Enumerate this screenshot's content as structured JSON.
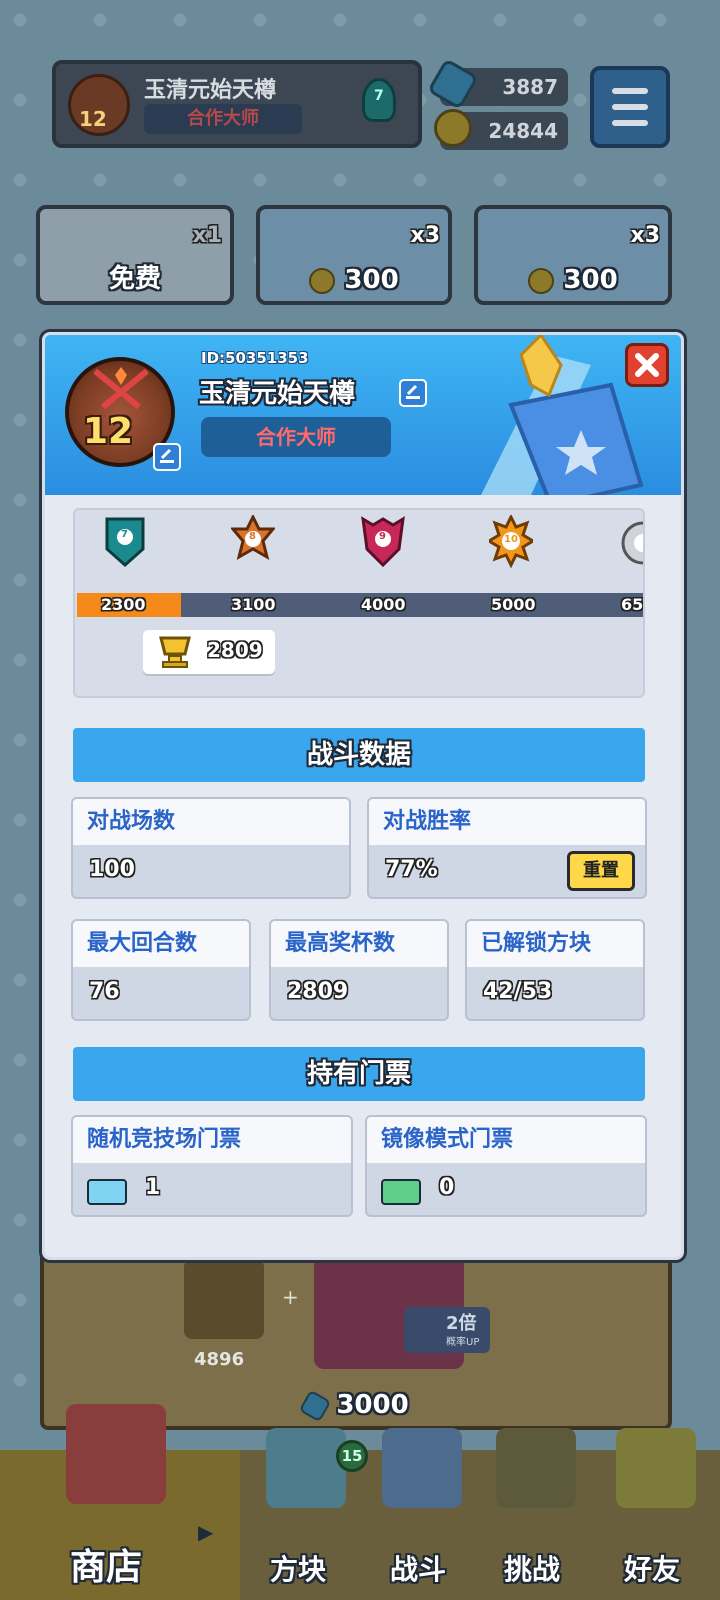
{
  "top_bar": {
    "player_name": "玉清元始天樽",
    "player_title": "合作大师",
    "level": "12",
    "rank_badge_num": "7",
    "gems": "3887",
    "gold": "24844"
  },
  "shop": {
    "cards": [
      {
        "price": "免费",
        "qty": "x1"
      },
      {
        "price": "300",
        "qty": "x3"
      },
      {
        "price": "300",
        "qty": "x3"
      }
    ],
    "bundle_gold": "4896",
    "bundle_price": "3000",
    "bundle_bonus": "2倍",
    "bundle_bonus_sub": "概率UP"
  },
  "profile_modal": {
    "player_id": "ID:50351353",
    "player_name": "玉清元始天樽",
    "player_title": "合作大师",
    "level": "12",
    "trophy_road": {
      "milestones": [
        {
          "trophies": "2300",
          "rank": "7",
          "color": "#1a8a8f"
        },
        {
          "trophies": "3100",
          "rank": "8",
          "color": "#d9742a"
        },
        {
          "trophies": "4000",
          "rank": "9",
          "color": "#c8275a"
        },
        {
          "trophies": "5000",
          "rank": "10",
          "color": "#f2971c"
        },
        {
          "trophies": "65",
          "rank": "",
          "color": "#d0d4da"
        }
      ],
      "current_trophies": "2809",
      "progress_fraction": 0.18
    },
    "battle_data": {
      "header": "战斗数据",
      "matches_label": "对战场数",
      "matches_value": "100",
      "winrate_label": "对战胜率",
      "winrate_value": "77%",
      "reset_label": "重置",
      "max_rounds_label": "最大回合数",
      "max_rounds_value": "76",
      "max_trophies_label": "最高奖杯数",
      "max_trophies_value": "2809",
      "unlocked_label": "已解锁方块",
      "unlocked_value": "42/53"
    },
    "tickets": {
      "header": "持有门票",
      "random_label": "随机竞技场门票",
      "random_value": "1",
      "mirror_label": "镜像模式门票",
      "mirror_value": "0"
    }
  },
  "bottom_nav": {
    "items": [
      {
        "label": "商店"
      },
      {
        "label": "方块",
        "badge": "15"
      },
      {
        "label": "战斗"
      },
      {
        "label": "挑战"
      },
      {
        "label": "好友"
      }
    ]
  }
}
